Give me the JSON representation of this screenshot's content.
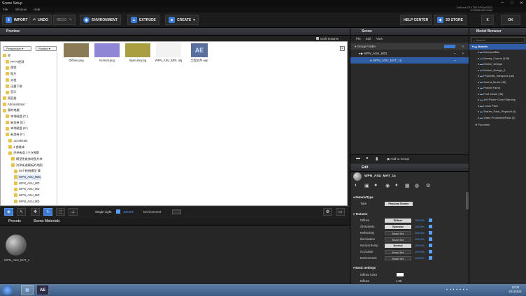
{
  "window": {
    "title": "Scene Setup",
    "minimize": "–",
    "maximize": "□",
    "close": "✕"
  },
  "menu": [
    "File",
    "Window",
    "Help"
  ],
  "gpu_info": [
    "GeForce GTX 750 Ti/PCIe/SSE2",
    "176/2048 MB VRAM"
  ],
  "toolbar": {
    "import": "IMPORT",
    "undo": "UNDO",
    "redo": "REDO",
    "environment": "ENVIRONMENT",
    "extrude": "EXTRUDE",
    "create": "CREATE",
    "help_center": "HELP CENTER",
    "store": "3D STORE",
    "x": "X",
    "ok": "OK"
  },
  "preview": {
    "title": "Preview",
    "draft_textures": "Draft Textures"
  },
  "browser": {
    "view_combo": "Perspective",
    "shade_combo": "Shaded",
    "tree": [
      {
        "label": "库",
        "level": 1
      },
      {
        "label": "PPTV视频",
        "level": 2
      },
      {
        "label": "视频",
        "level": 2
      },
      {
        "label": "图片",
        "level": 2
      },
      {
        "label": "文档",
        "level": 2
      },
      {
        "label": "迅雷下载",
        "level": 2
      },
      {
        "label": "音乐",
        "level": 2
      },
      {
        "label": "家庭组",
        "level": 1
      },
      {
        "label": "Administrator",
        "level": 1
      },
      {
        "label": "我的电脑",
        "level": 1
      },
      {
        "label": "本地磁盘 (C:)",
        "level": 2
      },
      {
        "label": "新加卷 (D:)",
        "level": 2
      },
      {
        "label": "本地磁盘 (E:)",
        "level": 2
      },
      {
        "label": "新加卷 (F:)",
        "level": 2
      },
      {
        "label": ".accelerate",
        "level": 3
      },
      {
        "label": "1 镜像体",
        "level": 3
      },
      {
        "label": "洪泽街道 1千万夜都",
        "level": 3
      },
      {
        "label": "模型免维修地图片库",
        "level": 4
      },
      {
        "label": "洪泽街道模板的地图",
        "level": 4
      },
      {
        "label": "48个枪械模型 模",
        "level": 5
      },
      {
        "label": "WPN_ASU_MDL",
        "level": 5
      },
      {
        "label": "WPN_ASU_MD",
        "level": 5
      },
      {
        "label": "WPN_ASU_MD",
        "level": 5
      },
      {
        "label": "WPN_ASU_MD",
        "level": 5
      },
      {
        "label": "WPN_ASU_MD",
        "level": 5
      }
    ],
    "files": [
      {
        "name": "Diffuse.png",
        "color": "#8a7a55"
      },
      {
        "name": "Normal.png",
        "color": "#8f86d6"
      },
      {
        "name": "Specular.png",
        "color": "#a8a040"
      },
      {
        "name": "WPN_ASU_MDL.obj",
        "color": "#f2f2f2"
      },
      {
        "name": "工程文件.aep",
        "color": "#5a6f9c",
        "glyph": "AE"
      }
    ]
  },
  "viewport_toolbar": {
    "light": "Single Light",
    "light_pct": "100.0%",
    "environment": "Environment"
  },
  "lower": {
    "tabs": [
      "Presets",
      "Scene Materials"
    ],
    "material_name": "WPN_ASU_MAT_1"
  },
  "scene": {
    "title": "Scene",
    "menu": [
      "File",
      "Edit",
      "View"
    ],
    "items": [
      {
        "label": "Group Folder",
        "level": 0
      },
      {
        "label": "WPN_ASU_MDL",
        "level": 1
      },
      {
        "label": "WPN_ASU_MAT_1a",
        "level": 2
      }
    ],
    "add_to_group": "Add to Group"
  },
  "edit": {
    "title": "Edit",
    "material_name": "WPN_ASU_MAT_1a",
    "material_type_header": "MaterialType",
    "type_label": "Type",
    "type_value": "Physical Shader",
    "textures_header": "Textures",
    "textures": [
      {
        "label": "Diffuse",
        "value": "Diffuse",
        "pct": "100.0%",
        "set": true
      },
      {
        "label": "Glossiness",
        "value": "Specular",
        "pct": "100.0%",
        "set": true
      },
      {
        "label": "Reflectivity",
        "value": "None Set",
        "pct": "100.0%",
        "set": false
      },
      {
        "label": "Illumination",
        "value": "None Set",
        "pct": "100.0%",
        "set": false
      },
      {
        "label": "Normal Bump",
        "value": "Normal",
        "pct": "100.0%",
        "set": true
      },
      {
        "label": "Occlusion",
        "value": "None Set",
        "pct": "100.0%",
        "set": false
      },
      {
        "label": "Environment",
        "value": "None Set",
        "pct": "100.0%",
        "set": false
      }
    ],
    "basic_settings": "Basic Settings",
    "diffuse_color_label": "Diffuse Color",
    "diffuse_label": "Diffuse",
    "diffuse_value": "1.00"
  },
  "model_browser": {
    "title": "Model Browser",
    "search_placeholder": "Search...",
    "root": "Models",
    "items": [
      "MetropoliBar",
      "Money_Casino (108)",
      "Motion_Design",
      "Motion_Design_2",
      "Projectile_Weapons (38)",
      "Sound_Music (38)",
      "Fractal Fama",
      "Fruit Model (38)",
      "Jet+Plane+Cars+Starship",
      "Locus Pack",
      "Starter_Pack_Physical (4)",
      "Video ProductionPack (3)"
    ],
    "favorites": "Favorites"
  },
  "taskbar": {
    "time": "12:00",
    "date": "2014/3/21",
    "app_label": "AE"
  },
  "accent": "#3b7bd8"
}
